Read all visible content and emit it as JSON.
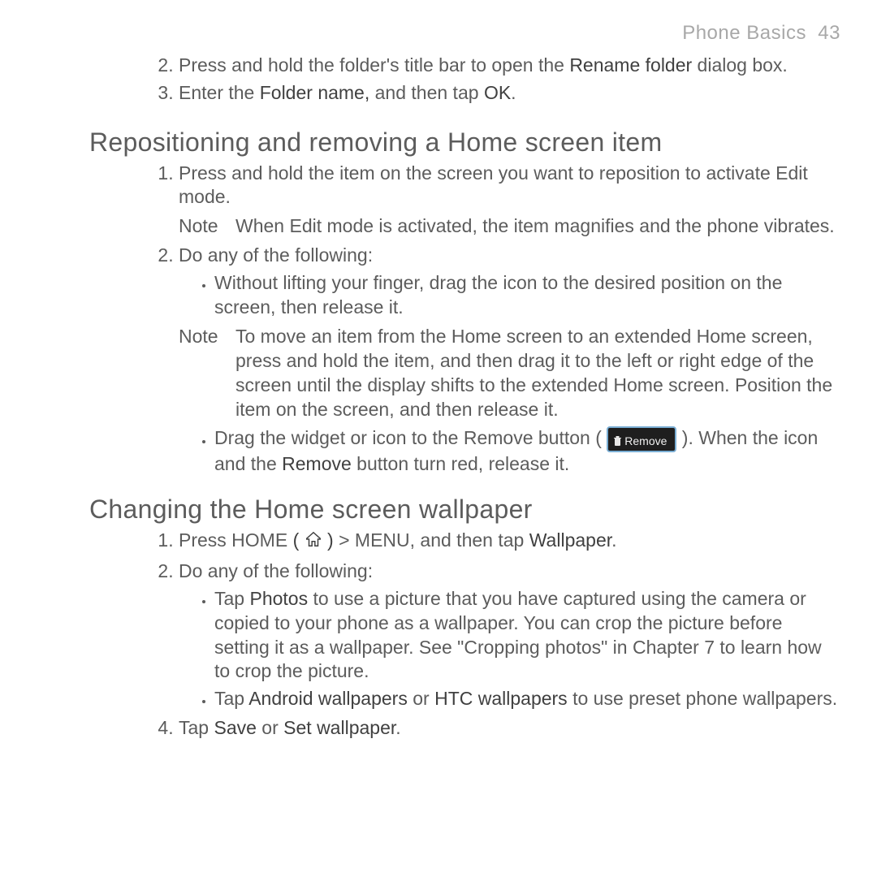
{
  "header": {
    "title": "Phone Basics",
    "page_no": "43"
  },
  "top_steps": {
    "start": 2,
    "items": [
      {
        "pre": "Press and hold the folder's title bar to open the ",
        "em1": "Rename folder",
        "post": " dialog box."
      },
      {
        "pre": "Enter the ",
        "em1": "Folder name,",
        "mid": " and then tap ",
        "em2": "OK",
        "post": "."
      }
    ]
  },
  "section1": {
    "heading": "Repositioning and removing a Home screen item",
    "steps": [
      {
        "text": "Press and hold the item on the screen you want to reposition to activate Edit mode."
      },
      {
        "text": "Do any of the following:"
      }
    ],
    "note1": {
      "label": "Note",
      "text": "When Edit mode is activated, the item magnifies and the phone vibrates."
    },
    "bullets1": [
      "Without lifting your finger, drag the icon to the desired position on the screen, then release it."
    ],
    "note2": {
      "label": "Note",
      "text": "To move an item from the Home screen to an extended Home screen, press and hold the item, and then drag it to the left or right edge of the screen until the display shifts to the extended Home screen. Position the item on the screen, and then release it."
    },
    "bullets2": {
      "pre": "Drag the widget or icon to the Remove button ( ",
      "btn_label": "Remove",
      "post1": " ). When the icon and the ",
      "em": "Remove",
      "post2": " button turn red, release it."
    }
  },
  "section2": {
    "heading": "Changing the Home screen wallpaper",
    "step1": {
      "pre": "Press HOME ",
      "paren_open": "( ",
      "paren_close": " )",
      "mid": " > MENU, and then tap ",
      "em": "Wallpaper",
      "post": "."
    },
    "step2": "Do any of the following:",
    "bullets": [
      {
        "pre": "Tap ",
        "em1": "Photos",
        "post": " to use a picture that you have captured using the camera or copied to your phone as a wallpaper. You can crop the picture before setting it as a wallpaper. See \"Cropping photos\" in Chapter 7 to learn how to crop the picture."
      },
      {
        "pre": "Tap ",
        "em1": "Android wallpapers",
        "mid": " or ",
        "em2": "HTC wallpapers",
        "post": " to use preset phone wallpapers."
      }
    ],
    "step4": {
      "num": 4,
      "pre": "Tap ",
      "em1": "Save",
      "mid": " or ",
      "em2": "Set wallpaper",
      "post": "."
    }
  }
}
